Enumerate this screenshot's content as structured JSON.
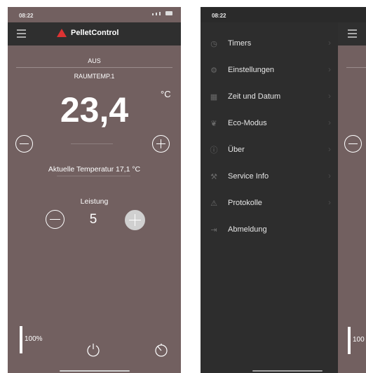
{
  "screen1": {
    "status_time": "08:22",
    "brand": "PelletControl",
    "state": "AUS",
    "room": "RAUMTEMP.1",
    "setpoint": "23,4",
    "unit": "°C",
    "current_temp": "Aktuelle Temperatur 17,1 °C",
    "power_label": "Leistung",
    "power_value": "5",
    "level_percent": "100%",
    "icons": {
      "menu": "hamburger-icon",
      "decrease_temp": "minus-circle-icon",
      "increase_temp": "plus-circle-icon",
      "power_off": "power-icon",
      "timer": "timer-icon"
    }
  },
  "screen2": {
    "status_time": "08:22",
    "menu_items": [
      {
        "label": "Timers",
        "icon": "clock-icon"
      },
      {
        "label": "Einstellungen",
        "icon": "gear-icon"
      },
      {
        "label": "Zeit und Datum",
        "icon": "calendar-icon"
      },
      {
        "label": "Eco-Modus",
        "icon": "leaf-icon"
      },
      {
        "label": "Über",
        "icon": "info-icon"
      },
      {
        "label": "Service Info",
        "icon": "wrench-icon"
      },
      {
        "label": "Protokolle",
        "icon": "warning-icon"
      },
      {
        "label": "Abmeldung",
        "icon": "logout-icon"
      }
    ],
    "peek_percent": "100"
  },
  "colors": {
    "accent": "#726060",
    "menu_bg": "#2d2d2d",
    "logo_red": "#dd3333"
  }
}
